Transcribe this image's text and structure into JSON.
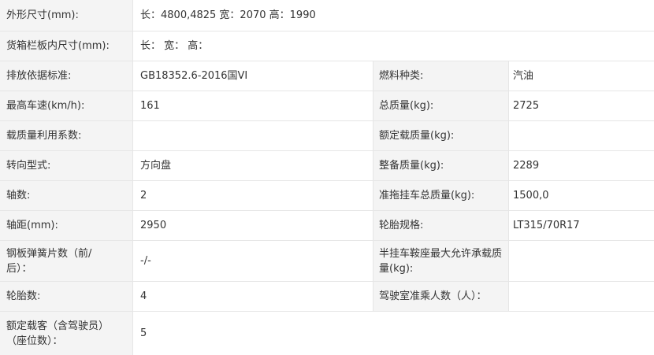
{
  "rows": [
    {
      "label": "外形尺寸(mm):",
      "value": "长：4800,4825 宽：2070 高：1990"
    },
    {
      "label": "货箱栏板内尺寸(mm):",
      "value": "长：  宽：  高："
    },
    {
      "label": "排放依据标准:",
      "value": "GB18352.6-2016国VI",
      "label2": "燃料种类:",
      "value2": "汽油"
    },
    {
      "label": "最高车速(km/h):",
      "value": "161",
      "label2": "总质量(kg):",
      "value2": "2725"
    },
    {
      "label": "载质量利用系数:",
      "value": "",
      "label2": "额定载质量(kg):",
      "value2": ""
    },
    {
      "label": "转向型式:",
      "value": "方向盘",
      "label2": "整备质量(kg):",
      "value2": "2289"
    },
    {
      "label": "轴数:",
      "value": "2",
      "label2": "准拖挂车总质量(kg):",
      "value2": "1500,0"
    },
    {
      "label": "轴距(mm):",
      "value": "2950",
      "label2": "轮胎规格:",
      "value2": "LT315/70R17"
    },
    {
      "label": "钢板弹簧片数（前/后）：",
      "value": "-/-",
      "label2": "半挂车鞍座最大允许承载质量(kg):",
      "value2": ""
    },
    {
      "label": "轮胎数:",
      "value": "4",
      "label2": "驾驶室准乘人数（人）：",
      "value2": ""
    },
    {
      "label": "额定载客（含驾驶员）（座位数）：",
      "value": "5"
    }
  ]
}
